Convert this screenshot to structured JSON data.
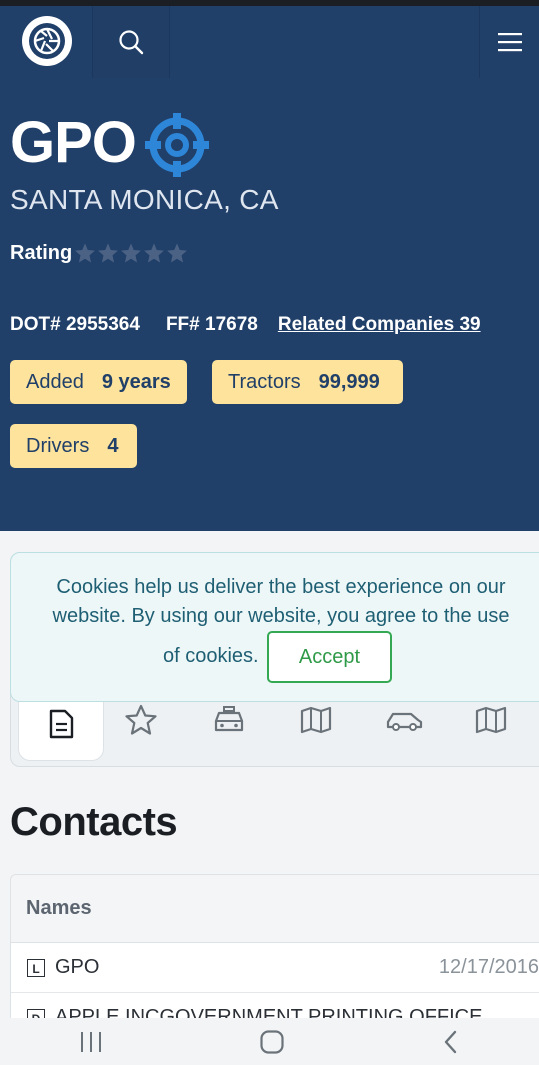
{
  "header": {
    "logo_icon": "camera-shutter-icon",
    "search_icon": "search-icon",
    "menu_icon": "hamburger-menu-icon"
  },
  "company": {
    "name": "GPO",
    "target_icon": "target-icon",
    "location": "SANTA MONICA, CA",
    "rating_label": "Rating",
    "rating_stars": 0,
    "rating_max": 5
  },
  "ids": {
    "dot_label": "DOT#",
    "dot_value": "2955364",
    "ff_label": "FF#",
    "ff_value": "17678",
    "related_label": "Related Companies",
    "related_count": "39"
  },
  "chips": {
    "added_label": "Added",
    "added_value": "9 years",
    "tractors_label": "Tractors",
    "tractors_value": "99,999",
    "drivers_label": "Drivers",
    "drivers_value": "4"
  },
  "cookie": {
    "text": "Cookies help us deliver the best experience on our website. By using our website, you agree to the use",
    "text_suffix": "of cookies.",
    "accept_label": "Accept"
  },
  "tabs": [
    {
      "icon": "document-icon"
    },
    {
      "icon": "star-icon"
    },
    {
      "icon": "taxi-icon"
    },
    {
      "icon": "map-icon"
    },
    {
      "icon": "car-icon"
    },
    {
      "icon": "map-icon"
    }
  ],
  "contacts": {
    "title": "Contacts",
    "column": "Names",
    "rows": [
      {
        "badge": "L",
        "name": "GPO",
        "date": "12/17/2016"
      },
      {
        "badge": "D",
        "name": "APPLE INCGOVERNMENT PRINTING OFFICE",
        "date": ""
      }
    ]
  },
  "colors": {
    "hero": "#203f69",
    "chip": "#fde39b",
    "accent_blue": "#2e86d8",
    "accept_green": "#34a852"
  }
}
